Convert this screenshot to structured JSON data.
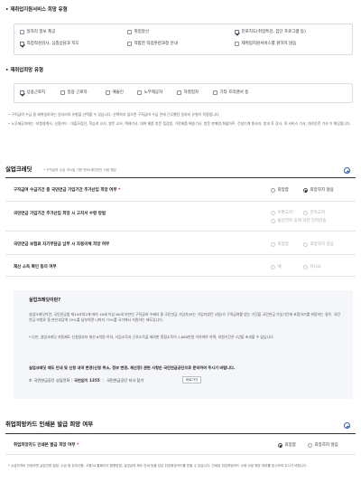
{
  "reemployment_service": {
    "title": "• 재취업지원서비스 희망 유형",
    "options": [
      {
        "label": "일자리 정보 제공",
        "checked": false
      },
      {
        "label": "취업알선",
        "checked": false
      },
      {
        "label": "진로지도(취업특강, 집단 프로그램 등)",
        "checked": true
      },
      {
        "label": "직업적성검사, 심층상담과 지도",
        "checked": true
      },
      {
        "label": "적합한 직업훈련과정 안내",
        "checked": false
      },
      {
        "label": "재취업지원서비스를 원하지 않음",
        "checked": false
      }
    ]
  },
  "desired_type": {
    "title": "• 재취업희망 유형",
    "options": [
      {
        "label": "상용근로자",
        "checked": true
      },
      {
        "label": "일용 근로자",
        "checked": false
      },
      {
        "label": "예술인",
        "checked": false
      },
      {
        "label": "노무제공자",
        "checked": false
      },
      {
        "label": "자영업자",
        "checked": false
      },
      {
        "label": "기타 프리랜서 등",
        "checked": false
      }
    ],
    "notes": [
      "• 구직급여 수급 중 재취업하려는 일자리의 유형을 선택할 수 있습니다. 선택하지 않으면 구직급여 수급 전에 근무했던 일자리 유형이 적용됩니다.",
      "• 노무제공자에는 '보험설계사, 신용카드 · 대출모집인, 학습지 교사, 방문 교사, 택배기사, 대여 제품 방문 점검원, 가전제품 배송기사, 방문 판매원,화물차주, 건설기계 종사자, 방과 후 강사, 퀵 서비스 기사, 대리운전 기사'가 해당됩니다."
    ]
  },
  "unemployment_credit": {
    "title": "실업크레딧",
    "subtitle": "• 구직급여 수급 개시일 기준 만60세미만인 사람 해당",
    "rows": [
      {
        "label": "구직급여 수급기간 중 국민연금 가입기간 추가산입 희망 여부",
        "required": true,
        "options": [
          {
            "label": "희망함",
            "on": false,
            "disabled": false
          },
          {
            "label": "희망하지 않음",
            "on": true,
            "disabled": false
          }
        ]
      },
      {
        "label": "국민연금 가입기간 추가산입 희망 시 고지서 수령 방법",
        "required": false,
        "options": [
          {
            "label": "우편고지",
            "on": false,
            "disabled": true
          },
          {
            "label": "전자고지",
            "on": false,
            "disabled": true
          },
          {
            "label": "울산전자 동에 의한 전자전송",
            "on": false,
            "disabled": true
          }
        ]
      },
      {
        "label": "국민연금 보험료 자기부담금 납부 시 자동이체 희망 여부",
        "required": false,
        "options": [
          {
            "label": "희망함",
            "on": false,
            "disabled": true
          },
          {
            "label": "희망하지 않음",
            "on": false,
            "disabled": true
          }
        ]
      },
      {
        "label": "재산 소득 확인 동의 여부",
        "required": false,
        "options": [
          {
            "label": "예",
            "on": false,
            "disabled": true
          },
          {
            "label": "아니오",
            "on": false,
            "disabled": true
          }
        ]
      }
    ],
    "info": {
      "title": "실업크레딧이란?",
      "body": "실업크레딧이란, 국민연금법 제19조의2에 따라 18세 이상 60세 미만인 구직급여 수혜자 중 국민연금 가입자(또는 가입자였던 사람)가 구직급여를 받는 기간을 국민연금 가입기간에 포함하기를 희망하는 경우, 국민연금 보험료 중 본인부담액 25%를 납부하면 나머지 75%를 국가에서 지원하는 제도입니다.",
      "extra": "* 다만, 실업크레딧 지원제도 신청일부터 재산 6억원 이하, 사업소득과 근로소득을 제외한 종합소득이 1,680만원 이하여야 하며, 지원기간은 1년을 초과할 수 없습니다.",
      "contact_text": "실업크레딧 제도 안내 및 신청 내역 변경(신청 취소, 정보 변경, 재산정) 관련 사항은 국민연금공단으로 문의하여 주시기 바랍니다.",
      "phone_label": "국민연금공단 상담전화 :",
      "phone": "국번없이 1355",
      "branch_label": "국민연금공단 지사 찾기",
      "shortcut_button": "바로가기"
    }
  },
  "card_section": {
    "title": "취업희망카드 인쇄본 발급 희망 여부",
    "row_label": "취업희망카드 인쇄본 발급 희망 여부",
    "options": [
      {
        "label": "희망함",
        "on": true
      },
      {
        "label": "희망하지 않음",
        "on": false
      }
    ],
    "note": "* 수급자격이 인정되면 실업인정 일정, 수급 중 유의사항, 고용24 홈페이지 활용방법, 실업급여 제도 안내 등을 담은 취업희망카드를 받을 수 있습니다. 인쇄된 취업희망카드 수령 수령 희망 여부를 표시하여 주시기 바랍니다."
  },
  "colors": {
    "accent": "#2b59c3",
    "required": "#e0312f"
  }
}
